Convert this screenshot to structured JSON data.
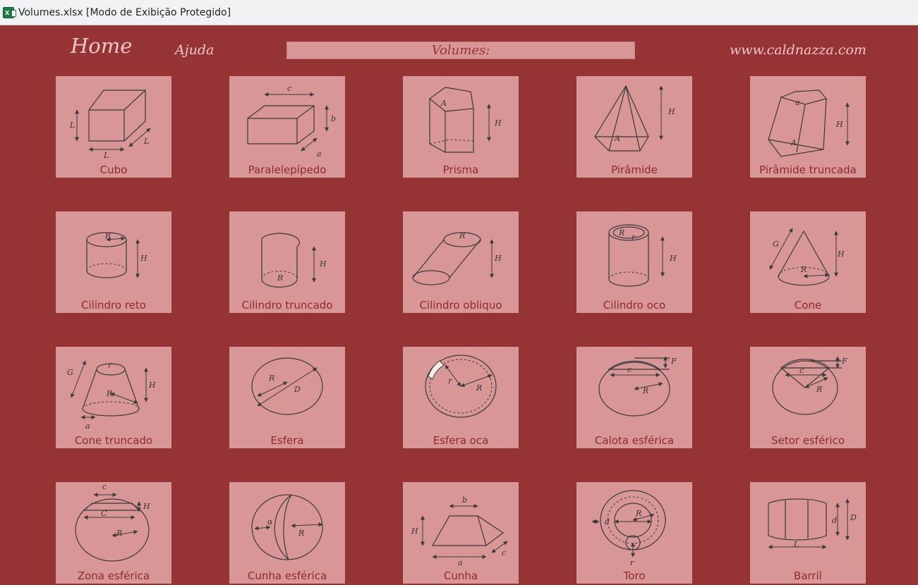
{
  "window": {
    "title": "Volumes.xlsx  [Modo de Exibição Protegido]"
  },
  "nav": {
    "home": "Home",
    "help": "Ajuda",
    "website": "www.caldnazza.com"
  },
  "header": {
    "title": "Volumes:"
  },
  "colors": {
    "background": "#963334",
    "card": "#d99697",
    "label": "#8e2a2b"
  },
  "shapes": [
    {
      "label": "Cubo",
      "letters": [
        "L",
        "L",
        "L"
      ]
    },
    {
      "label": "Paralelepípedo",
      "letters": [
        "c",
        "b",
        "a"
      ]
    },
    {
      "label": "Prisma",
      "letters": [
        "A",
        "H"
      ]
    },
    {
      "label": "Pirâmide",
      "letters": [
        "H",
        "A"
      ]
    },
    {
      "label": "Pirâmide truncada",
      "letters": [
        "a",
        "H",
        "A"
      ]
    },
    {
      "label": "Cilindro reto",
      "letters": [
        "R",
        "H"
      ]
    },
    {
      "label": "Cilindro truncado",
      "letters": [
        "H",
        "R"
      ]
    },
    {
      "label": "Cilindro obliquo",
      "letters": [
        "R",
        "H"
      ]
    },
    {
      "label": "Cilindro oco",
      "letters": [
        "R",
        "r",
        "H"
      ]
    },
    {
      "label": "Cone",
      "letters": [
        "G",
        "H",
        "R"
      ]
    },
    {
      "label": "Cone truncado",
      "letters": [
        "G",
        "r",
        "H",
        "R",
        "a"
      ]
    },
    {
      "label": "Esfera",
      "letters": [
        "R",
        "D"
      ]
    },
    {
      "label": "Esfera oca",
      "letters": [
        "r",
        "R"
      ]
    },
    {
      "label": "Calota esférica",
      "letters": [
        "F",
        "c",
        "R"
      ]
    },
    {
      "label": "Setor esférico",
      "letters": [
        "F",
        "c",
        "R"
      ]
    },
    {
      "label": "Zona esférica",
      "letters": [
        "c",
        "H",
        "C",
        "R"
      ]
    },
    {
      "label": "Cunha esférica",
      "letters": [
        "α",
        "R"
      ]
    },
    {
      "label": "Cunha",
      "letters": [
        "b",
        "H",
        "a",
        "c"
      ]
    },
    {
      "label": "Toro",
      "letters": [
        "d",
        "R",
        "r"
      ]
    },
    {
      "label": "Barril",
      "letters": [
        "d",
        "D",
        "L"
      ]
    }
  ]
}
